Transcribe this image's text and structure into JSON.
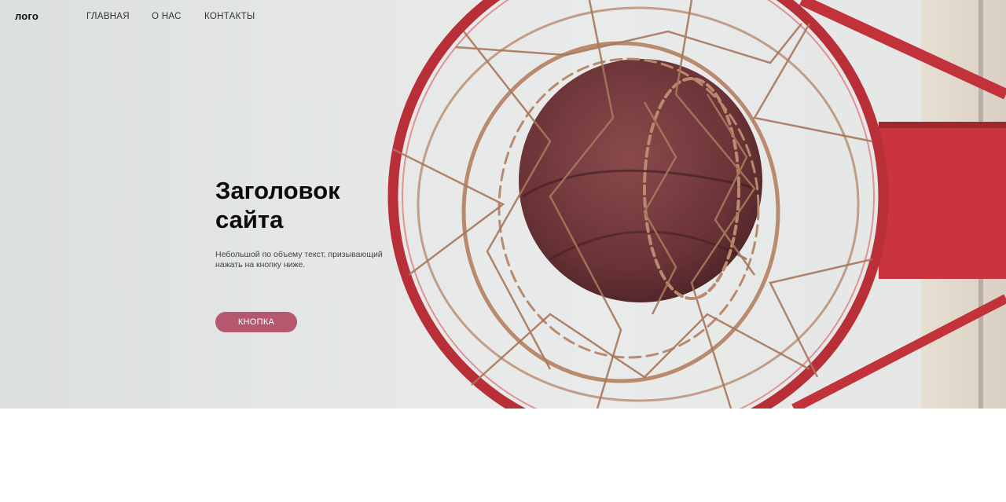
{
  "nav": {
    "logo": "лого",
    "links": [
      "ГЛАВНАЯ",
      "О НАС",
      "КОНТАКТЫ"
    ]
  },
  "hero": {
    "title": "Заголовок сайта",
    "text": "Небольшой по объему текст, призывающий нажать на кнопку ниже.",
    "button_label": "КНОПКА",
    "photo_subject": "basketball-hoop-with-ball"
  },
  "colors": {
    "accent": "#b4576f",
    "rim": "#c1323a",
    "net": "#b98a6e",
    "ball": "#6e3538"
  }
}
